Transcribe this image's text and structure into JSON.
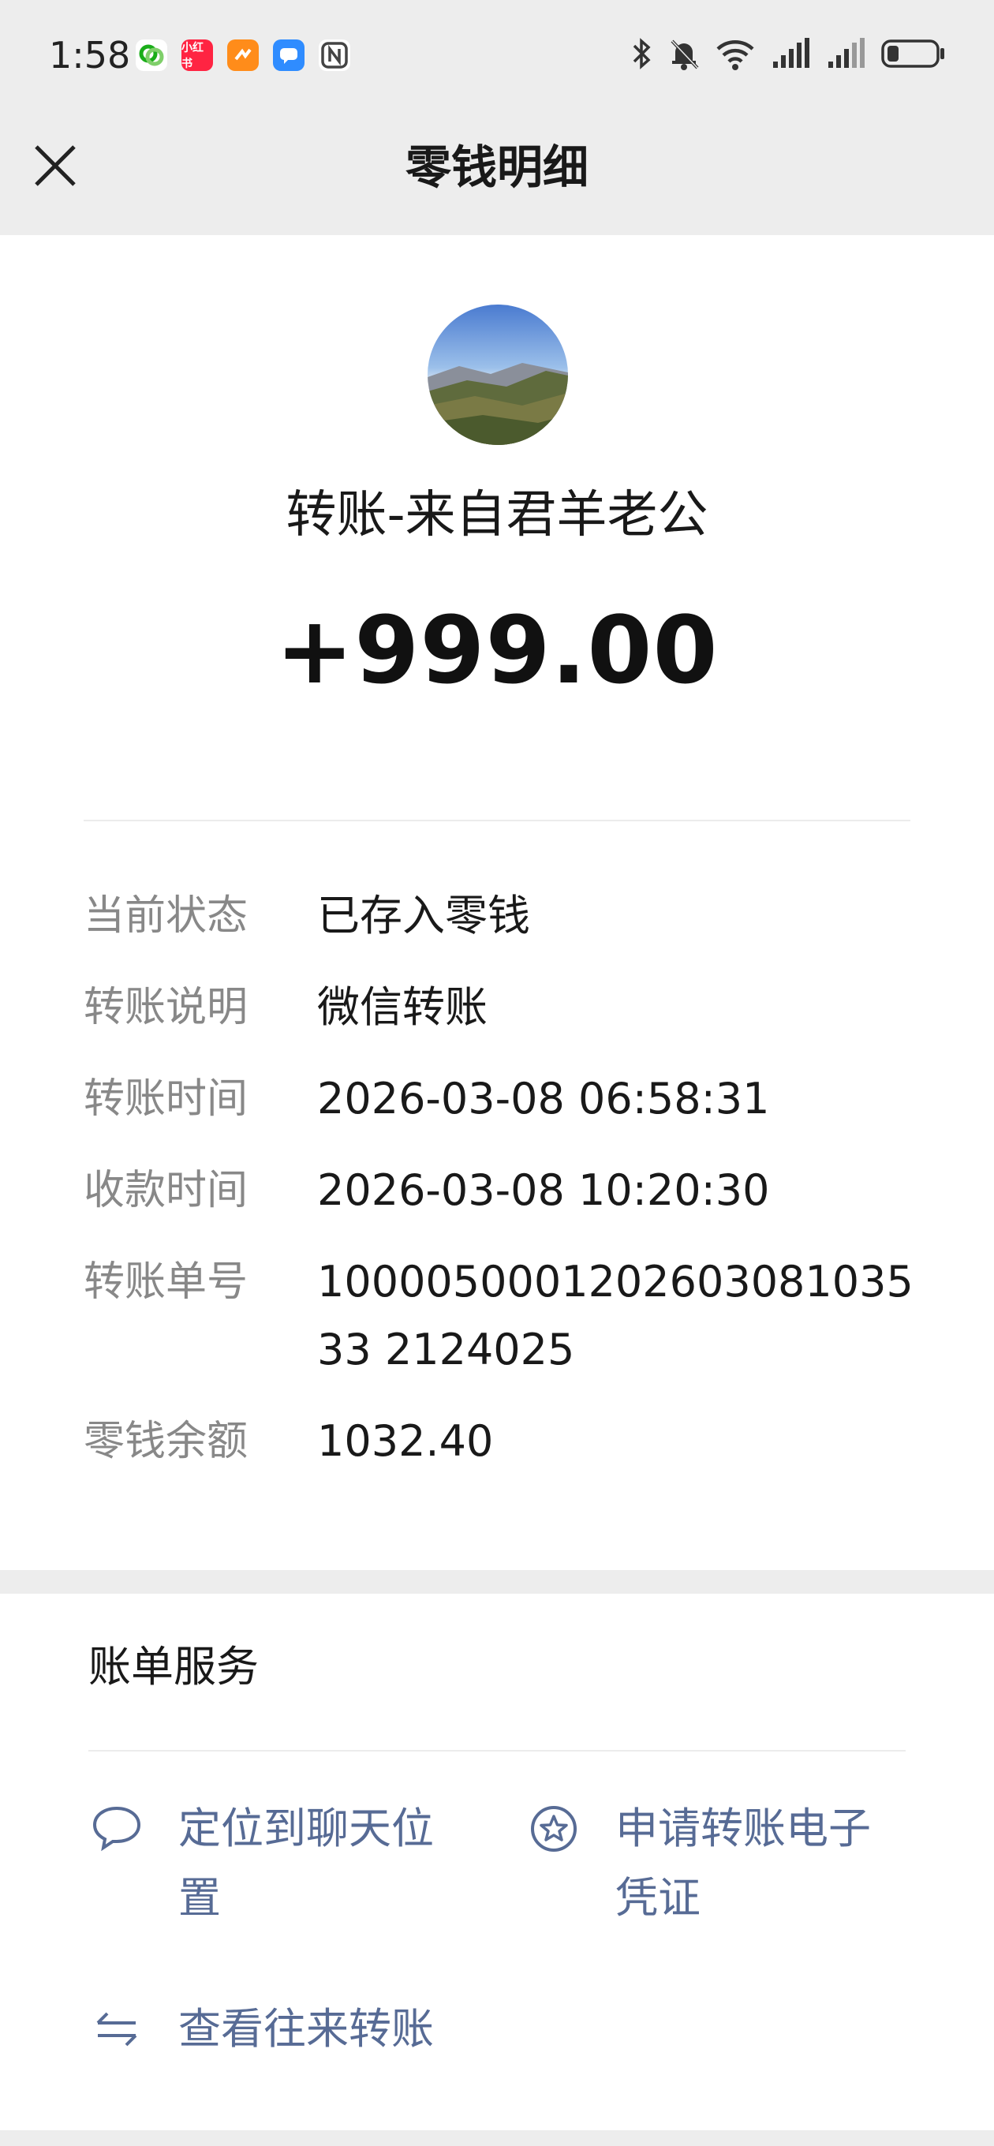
{
  "status_bar": {
    "time": "1:58",
    "apps": [
      {
        "name": "wechat-app-icon",
        "label": "",
        "color": "#1aad19"
      },
      {
        "name": "xiaohongshu-app-icon",
        "label": "小红书",
        "color": "#ff2442"
      },
      {
        "name": "orange-app-icon",
        "label": "",
        "color": "#ff8c1a"
      },
      {
        "name": "message-app-icon",
        "label": "",
        "color": "#2f8cff"
      },
      {
        "name": "nfc-icon",
        "label": "",
        "color": "#555555"
      }
    ]
  },
  "nav": {
    "title": "零钱明细"
  },
  "transfer": {
    "title": "转账-来自君羊老公",
    "amount": "+999.00"
  },
  "details": [
    {
      "label": "当前状态",
      "value": "已存入零钱"
    },
    {
      "label": "转账说明",
      "value": "微信转账"
    },
    {
      "label": "转账时间",
      "value": "2026-03-08 06:58:31"
    },
    {
      "label": "收款时间",
      "value": "2026-03-08 10:20:30"
    },
    {
      "label": "转账单号",
      "value": "100005000120260308103533 2124025"
    },
    {
      "label": "零钱余额",
      "value": "1032.40"
    }
  ],
  "services": {
    "heading": "账单服务",
    "items": [
      {
        "icon": "chat-bubble-icon",
        "label": "定位到聊天位置"
      },
      {
        "icon": "star-badge-icon",
        "label": "申请转账电子凭证"
      },
      {
        "icon": "transfer-arrows-icon",
        "label": "查看往来转账"
      }
    ]
  },
  "colors": {
    "link": "#576b95",
    "label_gray": "#888888",
    "background": "#ededed"
  }
}
